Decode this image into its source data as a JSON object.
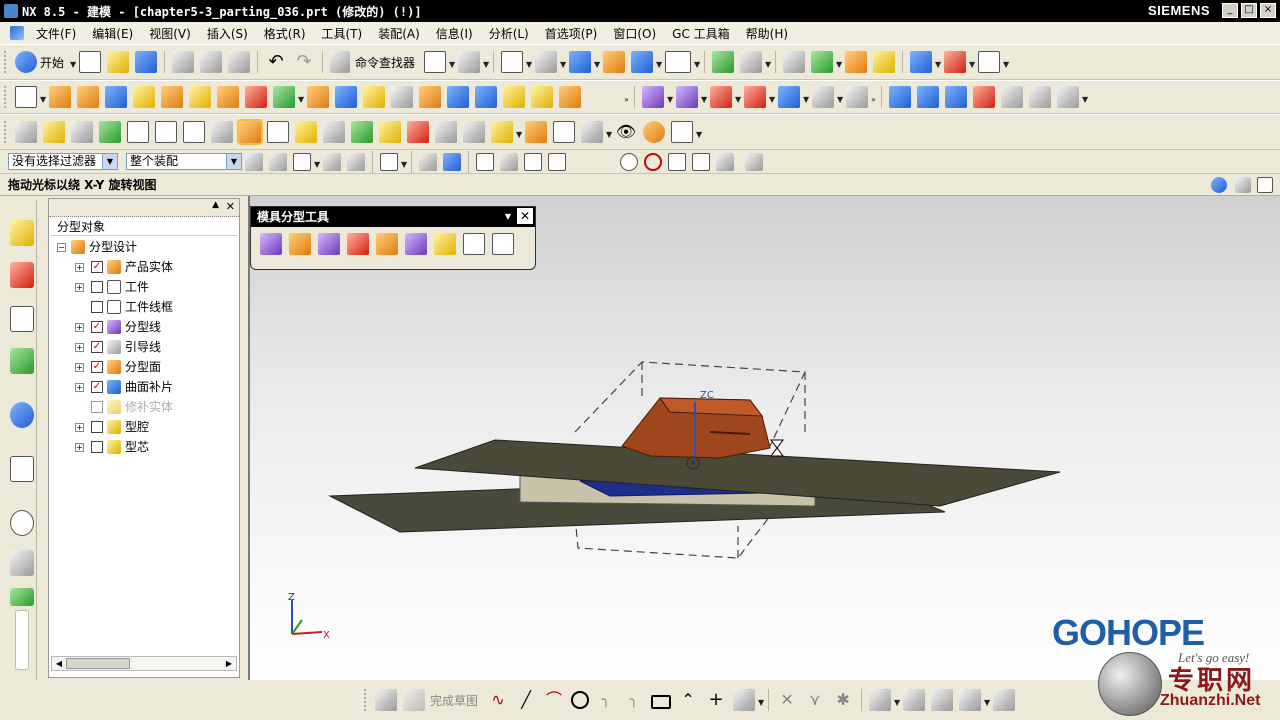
{
  "window": {
    "title": "NX 8.5 - 建模 - [chapter5-3_parting_036.prt (修改的)     (!)]",
    "brand": "SIEMENS",
    "controls": [
      "_",
      "□",
      "×"
    ]
  },
  "menubar": {
    "items": [
      "文件(F)",
      "编辑(E)",
      "视图(V)",
      "插入(S)",
      "格式(R)",
      "工具(T)",
      "装配(A)",
      "信息(I)",
      "分析(L)",
      "首选项(P)",
      "窗口(O)",
      "GC 工具箱",
      "帮助(H)"
    ]
  },
  "toolbar1": {
    "start_label": "开始",
    "finder_label": "命令查找器"
  },
  "selection_bar": {
    "filter_value": "没有选择过滤器",
    "scope_value": "整个装配"
  },
  "cue_line": {
    "text": "拖动光标以绕 X-Y 旋转视图"
  },
  "navigator": {
    "column_header": "分型对象",
    "items": [
      {
        "label": "分型设计",
        "checked": null
      },
      {
        "label": "产品实体",
        "checked": true
      },
      {
        "label": "工件",
        "checked": false
      },
      {
        "label": "工件线框",
        "checked": false
      },
      {
        "label": "分型线",
        "checked": true
      },
      {
        "label": "引导线",
        "checked": true
      },
      {
        "label": "分型面",
        "checked": true
      },
      {
        "label": "曲面补片",
        "checked": true
      },
      {
        "label": "修补实体",
        "checked": false
      },
      {
        "label": "型腔",
        "checked": false
      },
      {
        "label": "型芯",
        "checked": false
      }
    ]
  },
  "mold_tool": {
    "title": "模具分型工具"
  },
  "graphics": {
    "zc_label": "ZC",
    "triad": {
      "z": "Z",
      "x": "X",
      "y": "Y"
    }
  },
  "bottombar": {
    "finish_sketch_label": "完成草图"
  },
  "watermark": {
    "logo": "GOHOPE",
    "slogan": "Let's go easy!",
    "chinese": "专职网",
    "url": "Zhuanzhi.Net"
  }
}
